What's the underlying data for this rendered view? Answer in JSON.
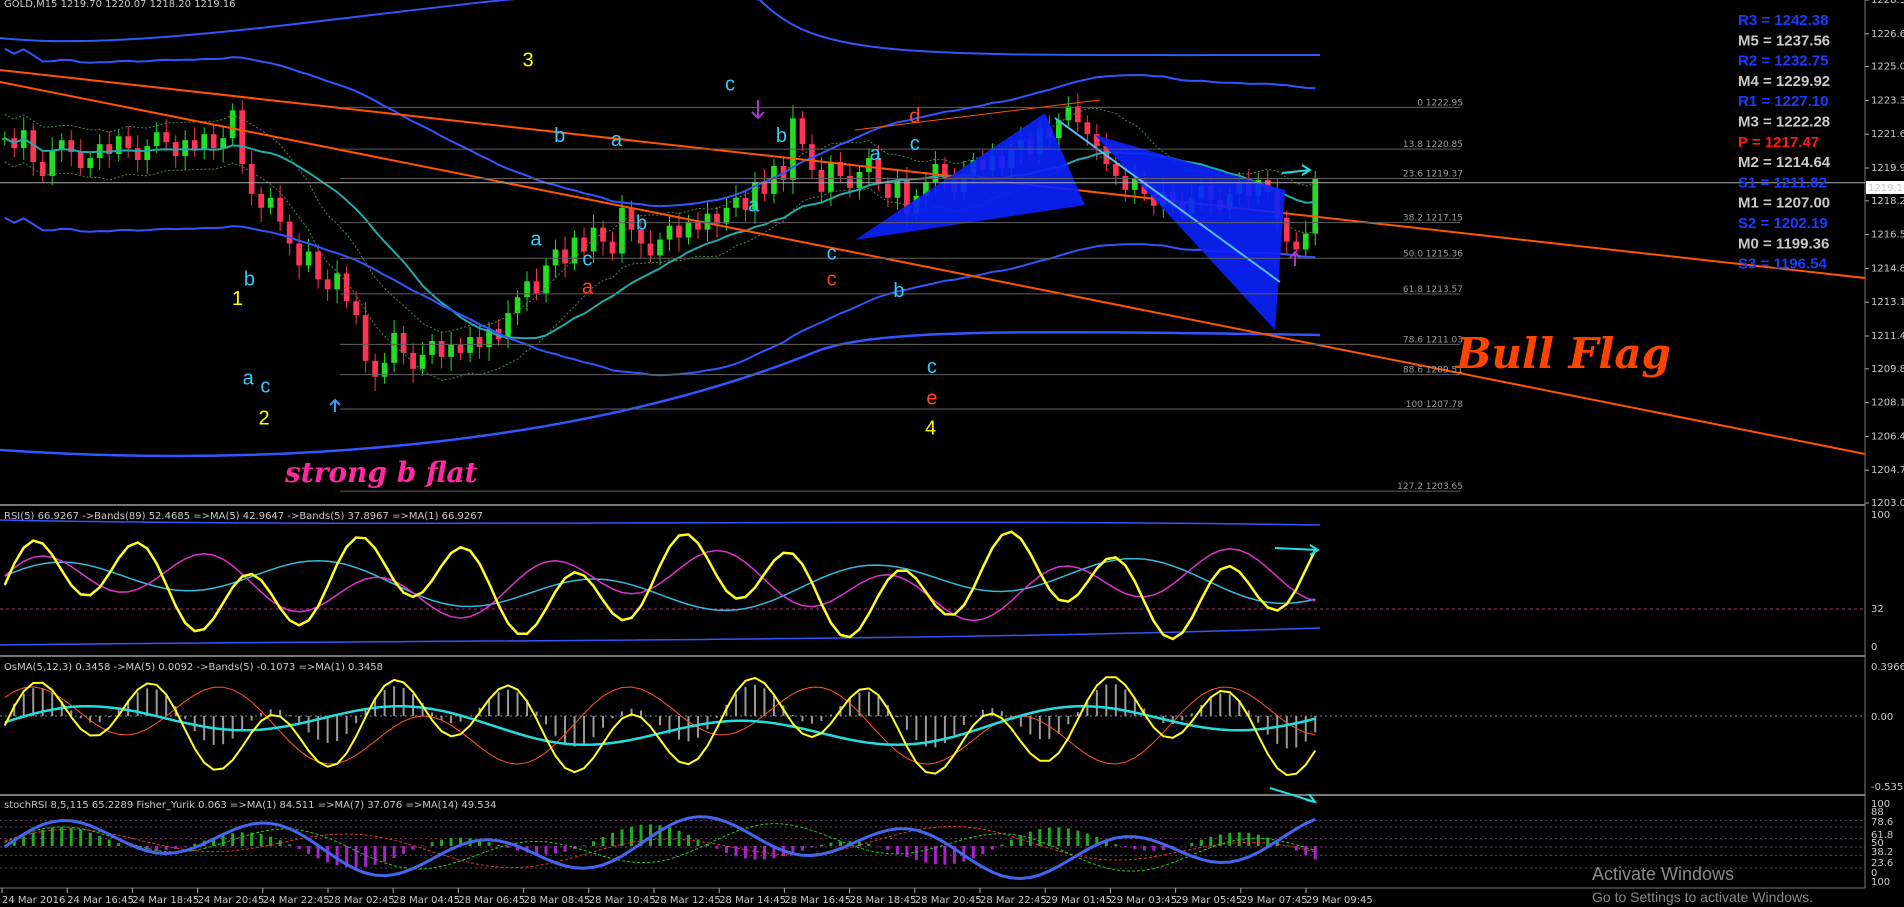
{
  "chart_data": [
    {
      "type": "candlestick",
      "title": "",
      "price_axis": {
        "range": [
          1203.05,
          1228.35
        ],
        "ticks": [
          "1228.35",
          "1226.65",
          "1225.00",
          "1223.30",
          "1221.60",
          "1219.90",
          "1218.25",
          "1216.55",
          "1214.85",
          "1213.15",
          "1211.45",
          "1209.80",
          "1208.10",
          "1206.40",
          "1204.70",
          "1203.05"
        ],
        "current_price": "1219.16"
      },
      "fib_levels": [
        {
          "label": "0 1222.95",
          "value": 1222.95
        },
        {
          "label": "13.8 1220.85",
          "value": 1220.85
        },
        {
          "label": "23.6 1219.37",
          "value": 1219.37
        },
        {
          "label": "38.2 1217.15",
          "value": 1217.15
        },
        {
          "label": "50.0 1215.36",
          "value": 1215.36
        },
        {
          "label": "61.8 1213.57",
          "value": 1213.57
        },
        {
          "label": "78.6 1211.03",
          "value": 1211.03
        },
        {
          "label": "88.6 1209.51",
          "value": 1209.51
        },
        {
          "label": "100 1207.78",
          "value": 1207.78
        },
        {
          "label": "127.2 1203.65",
          "value": 1203.65
        }
      ],
      "pivots": [
        {
          "label": "R3 = 1242.38",
          "color": "#1a3cff"
        },
        {
          "label": "M5 = 1237.56",
          "color": "#c8c8c8"
        },
        {
          "label": "R2 = 1232.75",
          "color": "#1a3cff"
        },
        {
          "label": "M4 = 1229.92",
          "color": "#c8c8c8"
        },
        {
          "label": "R1 = 1227.10",
          "color": "#1a3cff"
        },
        {
          "label": "M3 = 1222.28",
          "color": "#c8c8c8"
        },
        {
          "label": "P    = 1217.47",
          "color": "#ff1a1a"
        },
        {
          "label": "M2 = 1214.64",
          "color": "#c8c8c8"
        },
        {
          "label": "S1 = 1211.82",
          "color": "#1a3cff"
        },
        {
          "label": "M1 = 1207.00",
          "color": "#c8c8c8"
        },
        {
          "label": "S2 = 1202.19",
          "color": "#1a3cff"
        },
        {
          "label": "M0 = 1199.36",
          "color": "#c8c8c8"
        },
        {
          "label": "S3 = 1196.54",
          "color": "#1a3cff"
        }
      ],
      "wave_labels": [
        {
          "text": "1",
          "color": "#ffff00",
          "x": 0.18,
          "price": 1213.0
        },
        {
          "text": "2",
          "color": "#ffff00",
          "x": 0.2,
          "price": 1207.0
        },
        {
          "text": "3",
          "color": "#ffff00",
          "x": 0.4,
          "price": 1225.0
        },
        {
          "text": "4",
          "color": "#ffff00",
          "x": 0.705,
          "price": 1206.5
        },
        {
          "text": "a",
          "color": "#33ccff",
          "x": 0.188,
          "price": 1209.0
        },
        {
          "text": "c",
          "color": "#33ccff",
          "x": 0.201,
          "price": 1208.6
        },
        {
          "text": "b",
          "color": "#33ccff",
          "x": 0.189,
          "price": 1214.0
        },
        {
          "text": "a",
          "color": "#33ccff",
          "x": 0.406,
          "price": 1216.0
        },
        {
          "text": "b",
          "color": "#33ccff",
          "x": 0.424,
          "price": 1221.2
        },
        {
          "text": "a",
          "color": "#33ccff",
          "x": 0.467,
          "price": 1221.0
        },
        {
          "text": "c",
          "color": "#33ccff",
          "x": 0.445,
          "price": 1215.0
        },
        {
          "text": "a",
          "color": "#ff4422",
          "x": 0.445,
          "price": 1213.6
        },
        {
          "text": "b",
          "color": "#33ccff",
          "x": 0.486,
          "price": 1216.8
        },
        {
          "text": "c",
          "color": "#33ccff",
          "x": 0.553,
          "price": 1223.8
        },
        {
          "text": "a",
          "color": "#33ccff",
          "x": 0.571,
          "price": 1217.7
        },
        {
          "text": "b",
          "color": "#33ccff",
          "x": 0.592,
          "price": 1221.2
        },
        {
          "text": "c",
          "color": "#33ccff",
          "x": 0.63,
          "price": 1215.3
        },
        {
          "text": "c",
          "color": "#ff4422",
          "x": 0.63,
          "price": 1214.0
        },
        {
          "text": "b",
          "color": "#33ccff",
          "x": 0.681,
          "price": 1213.4
        },
        {
          "text": "a",
          "color": "#33ccff",
          "x": 0.663,
          "price": 1220.3
        },
        {
          "text": "c",
          "color": "#33ccff",
          "x": 0.693,
          "price": 1220.8
        },
        {
          "text": "d",
          "color": "#ff4422",
          "x": 0.693,
          "price": 1222.2
        },
        {
          "text": "c",
          "color": "#33ccff",
          "x": 0.706,
          "price": 1209.6
        },
        {
          "text": "e",
          "color": "#ff4422",
          "x": 0.706,
          "price": 1208.0
        }
      ],
      "annotations": [
        {
          "text": "Bull Flag",
          "color": "#ff4400"
        },
        {
          "text": "strong b flat",
          "color": "#ff2aa0"
        }
      ],
      "series_hint": {
        "start_price": 1221.4,
        "closes": [
          1221.4,
          1220.9,
          1221.8,
          1220.2,
          1219.5,
          1220.8,
          1221.3,
          1220.7,
          1219.9,
          1220.4,
          1221.1,
          1220.6,
          1221.5,
          1220.9,
          1220.3,
          1221.0,
          1221.7,
          1221.2,
          1220.5,
          1221.3,
          1220.8,
          1221.6,
          1220.9,
          1221.4,
          1222.8,
          1220.1,
          1218.6,
          1217.9,
          1218.4,
          1217.2,
          1216.1,
          1215.0,
          1215.7,
          1214.3,
          1213.8,
          1214.6,
          1213.2,
          1212.5,
          1210.2,
          1209.4,
          1210.1,
          1211.6,
          1210.6,
          1209.8,
          1210.5,
          1211.2,
          1210.4,
          1211.0,
          1210.6,
          1211.4,
          1210.9,
          1211.8,
          1211.3,
          1212.6,
          1213.4,
          1214.2,
          1213.6,
          1215.0,
          1215.8,
          1215.1,
          1216.4,
          1215.7,
          1216.9,
          1216.2,
          1215.6,
          1217.9,
          1216.8,
          1216.1,
          1215.5,
          1216.3,
          1217.0,
          1216.4,
          1217.2,
          1216.8,
          1217.6,
          1217.1,
          1217.9,
          1218.4,
          1217.8,
          1219.2,
          1218.6,
          1220.0,
          1219.3,
          1222.4,
          1221.1,
          1219.8,
          1218.7,
          1220.2,
          1219.5,
          1218.9,
          1219.7,
          1220.4,
          1219.1,
          1218.4,
          1219.3,
          1217.6,
          1218.5,
          1219.2,
          1220.1,
          1219.4,
          1218.7,
          1219.6,
          1220.3,
          1219.8,
          1220.5,
          1219.9,
          1220.8,
          1221.3,
          1220.6,
          1221.9,
          1221.4,
          1222.3,
          1223.0,
          1222.2,
          1221.6,
          1221.0,
          1220.1,
          1219.5,
          1218.8,
          1219.4,
          1218.6,
          1218.0,
          1218.7,
          1218.2,
          1217.6,
          1218.4,
          1219.0,
          1218.3,
          1217.8,
          1218.6,
          1219.2,
          1218.5,
          1219.3,
          1218.7,
          1217.4,
          1216.2,
          1215.8,
          1216.6,
          1219.4
        ]
      }
    },
    {
      "type": "line",
      "title": "RSI(5) 66.9267 ->Bands(89) 52.4685 =>MA(5) 42.9647 ->Bands(5) 37.8967 =>MA(1) 66.9267",
      "ylim": [
        0,
        100
      ],
      "y_ticks": [
        "100",
        "32",
        "0"
      ],
      "ref_level": 32
    },
    {
      "type": "line",
      "title": "OsMA(5,12,3) 0.3458 ->MA(5) 0.0092 ->Bands(5) -0.1073 =>MA(1) 0.3458",
      "ylim": [
        -0.5351,
        0.3966
      ],
      "y_ticks": [
        "0.3966",
        "0.00",
        "-0.5351"
      ]
    },
    {
      "type": "line",
      "title": "stochRSI 8,5,115 65.2289  Fisher_Yurik 0.063  =>MA(1) 84.511  =>MA(7) 37.076  =>MA(14) 49.534",
      "ylim": [
        0,
        100
      ],
      "y_ticks": [
        "100",
        "88",
        "78.6",
        "61.8",
        "50",
        "38.2",
        "23.6",
        "0",
        "100"
      ]
    }
  ],
  "time_axis": [
    "24 Mar 2016",
    "24 Mar 16:45",
    "24 Mar 18:45",
    "24 Mar 20:45",
    "24 Mar 22:45",
    "28 Mar 02:45",
    "28 Mar 04:45",
    "28 Mar 06:45",
    "28 Mar 08:45",
    "28 Mar 10:45",
    "28 Mar 12:45",
    "28 Mar 14:45",
    "28 Mar 16:45",
    "28 Mar 18:45",
    "28 Mar 20:45",
    "28 Mar 22:45",
    "29 Mar 01:45",
    "29 Mar 03:45",
    "29 Mar 05:45",
    "29 Mar 07:45",
    "29 Mar 09:45"
  ],
  "header_text": "GOLD,M15  1219.70 1220.07 1218.20 1219.16",
  "watermark": {
    "line1": "Activate Windows",
    "line2": "Go to Settings to activate Windows."
  },
  "colors": {
    "bull": "#22dd22",
    "bear": "#ff3355",
    "channel": "#ff5500",
    "band": "#3355ff",
    "teal": "#22aaaa",
    "fill": "#0a22ff"
  }
}
